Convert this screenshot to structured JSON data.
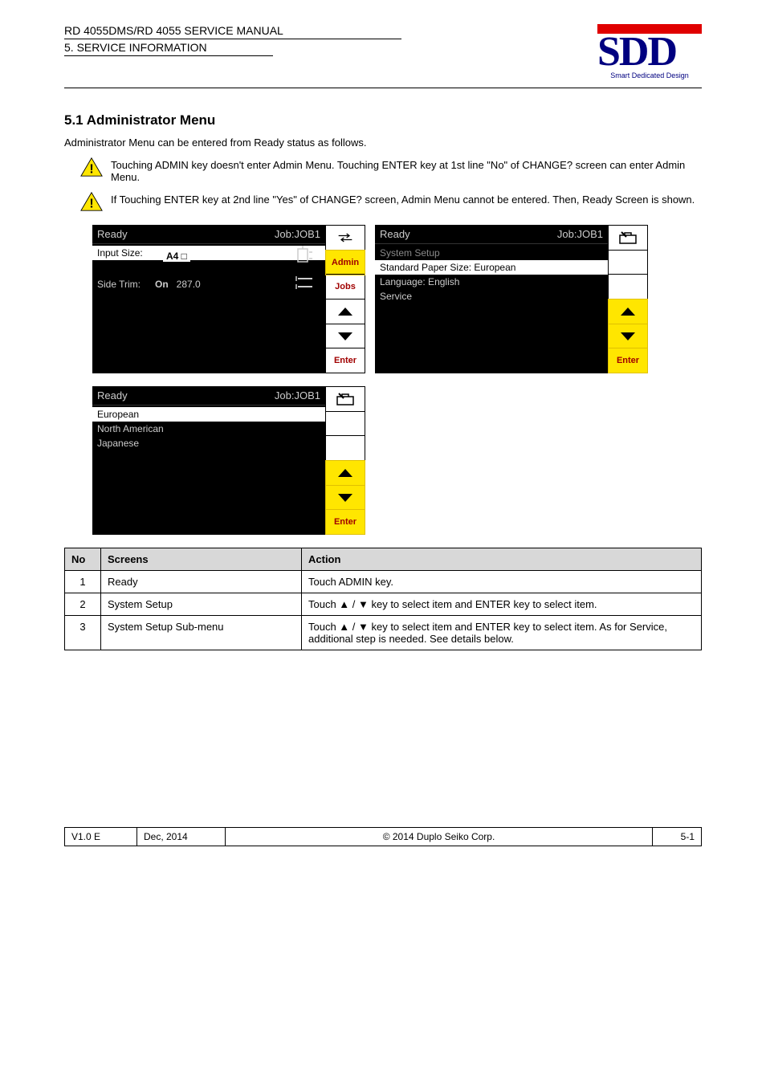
{
  "header": {
    "line1": "RD 4055DMS/RD 4055 SERVICE MANUAL",
    "line2": "5. SERVICE INFORMATION"
  },
  "logo": {
    "main": "SDD",
    "sub": "Smart Dedicated Design"
  },
  "section": {
    "title": "5.1 Administrator Menu",
    "intro": "Administrator Menu can be entered from Ready status as follows.",
    "warnings": {
      "w1": "Touching ADMIN key doesn't enter Admin Menu. Touching ENTER key at 1st line \"No\" of CHANGE? screen can enter Admin Menu.",
      "w2": "If Touching ENTER key at 2nd line \"Yes\" of CHANGE? screen, Admin Menu cannot be entered. Then, Ready Screen is shown."
    }
  },
  "screens": {
    "s1": {
      "ready": "Ready",
      "job": "Job:JOB1",
      "inputSizeLabel": "Input Size:",
      "inputSizeValue": "A4 □",
      "sideTrimLabel": "Side Trim:",
      "sideTrimOn": "On",
      "sideTrimVal": "287.0",
      "sidebar": {
        "arrows": "⇄",
        "admin": "Admin",
        "jobs": "Jobs",
        "up": "▲",
        "down": "▼",
        "enter": "Enter"
      }
    },
    "s2": {
      "ready": "Ready",
      "job": "Job:JOB1",
      "menuTitle": "System Setup",
      "item1": "Standard Paper Size: European",
      "item2": "Language: English",
      "item3": "Service",
      "sidebar": {
        "toolbox": "toolbox",
        "up": "▲",
        "down": "▼",
        "enter": "Enter"
      }
    },
    "s3": {
      "ready": "Ready",
      "job": "Job:JOB1",
      "opt1": "European",
      "opt2": "North American",
      "opt3": "Japanese",
      "sidebar": {
        "toolbox": "toolbox",
        "up": "▲",
        "down": "▼",
        "enter": "Enter"
      }
    }
  },
  "table": {
    "headNo": "No",
    "headScreen": "Screens",
    "headAction": "Action",
    "rows": [
      {
        "no": "1",
        "screen": "Ready",
        "action": "Touch ADMIN key."
      },
      {
        "no": "2",
        "screen": "System Setup",
        "action": "Touch ▲ / ▼ key to select item and ENTER key to select item."
      },
      {
        "no": "3",
        "screen": "System Setup Sub-menu",
        "action": "Touch ▲ / ▼ key to select item and ENTER key to select item. As for Service, additional step is needed. See details below."
      }
    ]
  },
  "footer": {
    "c1": "V1.0 E",
    "c2": "Dec, 2014",
    "c3": "© 2014 Duplo Seiko Corp.",
    "c4": "5-1"
  }
}
